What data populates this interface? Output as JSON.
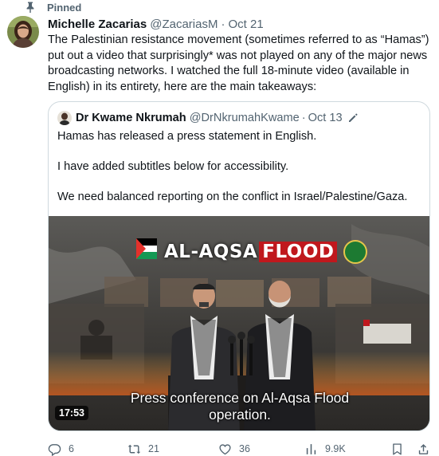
{
  "pinned": {
    "label": "Pinned"
  },
  "tweet": {
    "display_name": "Michelle Zacarias",
    "handle": "@ZacariasM",
    "separator": "·",
    "time": "Oct 21",
    "text": "The Palestinian resistance movement (sometimes referred to as “Hamas”) put out a video that surprisingly* was not played on any of the major news broadcasting networks. I watched the full 18-minute video (available in English) in its entirety, here are the main takeaways:"
  },
  "quote": {
    "display_name": "Dr Kwame Nkrumah",
    "handle": "@DrNkrumahKwame",
    "separator": "·",
    "time": "Oct 13",
    "paragraphs": [
      "Hamas has released a press statement in English.",
      "I have added subtitles below for accessibility.",
      "We need balanced reporting on the conflict in Israel/Palestine/Gaza."
    ],
    "video": {
      "banner_left": "AL-AQSA",
      "banner_right": "FLOOD",
      "subtitle_line1": "Press conference on Al-Aqsa Flood",
      "subtitle_line2": "operation.",
      "duration": "17:53"
    }
  },
  "actions": {
    "replies": "6",
    "reposts": "21",
    "likes": "36",
    "views": "9.9K"
  },
  "colors": {
    "text": "#0f1419",
    "muted": "#536471",
    "border": "#cfd9de",
    "banner_red": "#c0181d"
  },
  "icons": [
    "pin-icon",
    "edit-icon",
    "reply-icon",
    "repost-icon",
    "like-icon",
    "views-icon",
    "bookmark-icon",
    "share-icon"
  ]
}
